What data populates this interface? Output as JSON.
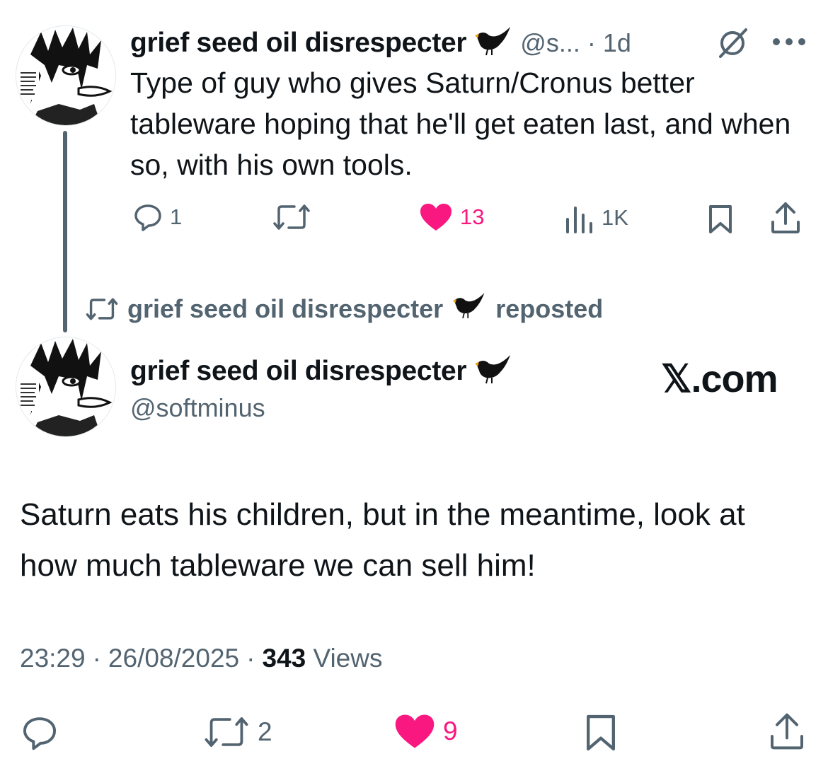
{
  "quoted_tweet": {
    "author_name": "grief seed oil disrespecter",
    "author_emoji_icon": "blackbird-icon",
    "handle_truncated": "@s...",
    "time_sep": "·",
    "time_ago": "1d",
    "text": "Type of guy who gives Saturn/Cronus better tableware hoping that he'll get eaten last, and when so, with his own tools.",
    "actions": {
      "replies": "1",
      "reposts": "",
      "likes": "13",
      "views": "1K"
    },
    "avatar_caption": "GOING TO DENBOW'S? MEAN BEING FORGOTTEN FROM THIS WORLD?!"
  },
  "repost_banner": {
    "name": "grief seed oil disrespecter",
    "label": "reposted"
  },
  "main_tweet": {
    "author_name": "grief seed oil disrespecter",
    "handle": "@softminus",
    "brand": "𝕏.com",
    "text": "Saturn eats his children, but in the meantime, look at how much tableware we can sell him!",
    "time": "23:29",
    "date": "26/08/2025",
    "sep": "·",
    "views_count": "343",
    "views_label": "Views",
    "actions": {
      "reposts": "2",
      "likes": "9"
    }
  },
  "colors": {
    "text": "#0f1419",
    "muted": "#536471",
    "like_pink": "#f91880"
  }
}
